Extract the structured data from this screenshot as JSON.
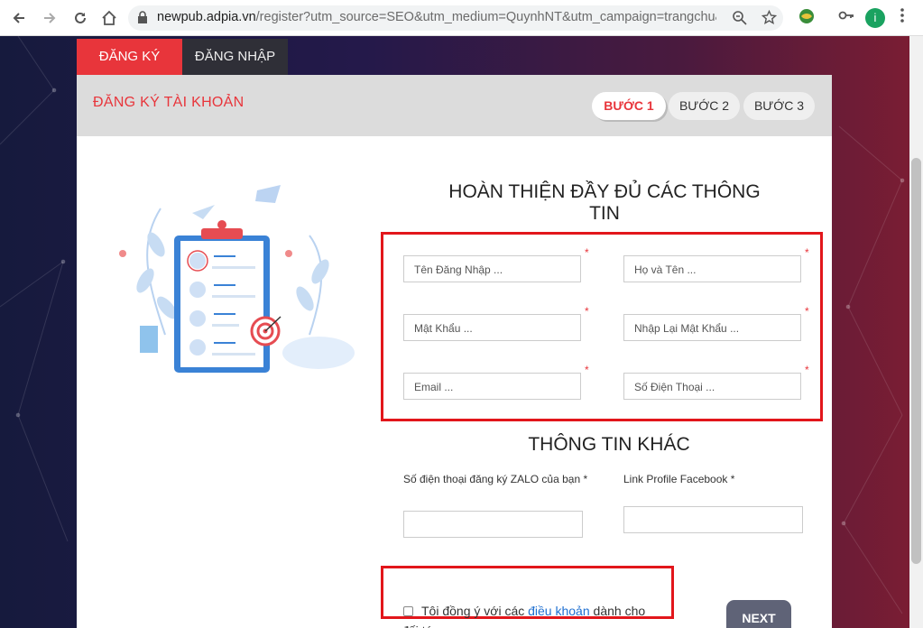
{
  "browser": {
    "url_host": "newpub.adpia.vn",
    "url_rest": "/register?utm_source=SEO&utm_medium=QuynhNT&utm_campaign=trangchu&...",
    "profile_initial": "i"
  },
  "tabs": {
    "register": "ĐĂNG KÝ",
    "login": "ĐĂNG NHẬP"
  },
  "panel": {
    "title": "ĐĂNG KÝ TÀI KHOẢN",
    "steps": [
      "BƯỚC 1",
      "BƯỚC 2",
      "BƯỚC 3"
    ]
  },
  "form": {
    "heading": "HOÀN THIỆN ĐẦY ĐỦ CÁC THÔNG TIN",
    "required_mark": "*",
    "fields": {
      "username": "Tên Đăng Nhập ...",
      "fullname": "Họ và Tên ...",
      "password": "Mật Khẩu ...",
      "confirm_password": "Nhập Lại Mật Khẩu ...",
      "email": "Email ...",
      "phone": "Số Điện Thoại ..."
    },
    "other_heading": "THÔNG TIN KHÁC",
    "zalo_label": "Số điện thoại đăng ký ZALO của bạn *",
    "facebook_label": "Link Profile Facebook *",
    "terms_prefix": "Tôi đồng ý với các ",
    "terms_link": "điều khoản",
    "terms_suffix": " dành cho đối tác",
    "next_label": "NEXT"
  },
  "colors": {
    "accent": "#e8353b",
    "highlight_box": "#e2161b",
    "next_button": "#5f6377"
  }
}
